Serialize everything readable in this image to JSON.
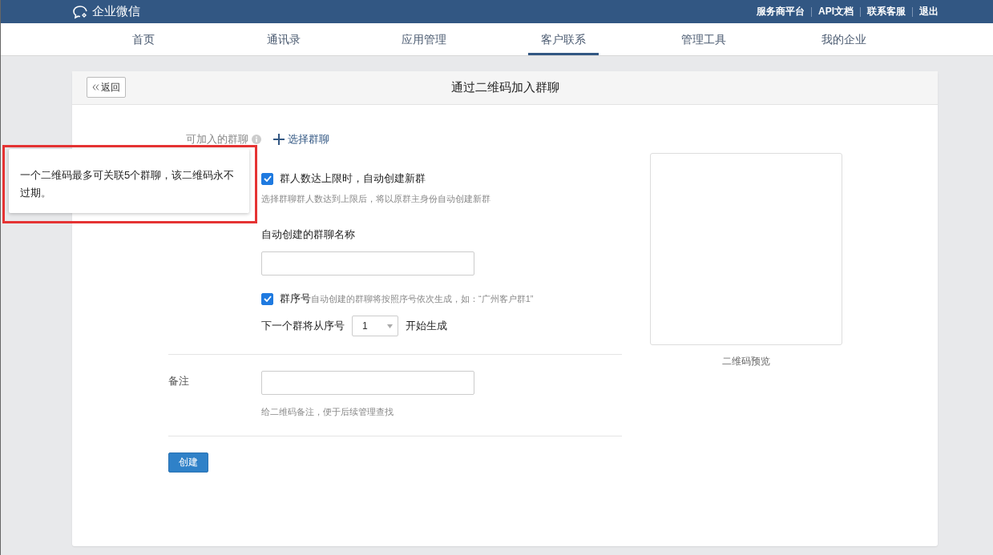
{
  "header": {
    "logo_text": "企业微信",
    "links": [
      "服务商平台",
      "API文档",
      "联系客服",
      "退出"
    ]
  },
  "nav": {
    "tabs": [
      {
        "label": "首页",
        "selected": false
      },
      {
        "label": "通讯录",
        "selected": false
      },
      {
        "label": "应用管理",
        "selected": false
      },
      {
        "label": "客户联系",
        "selected": true
      },
      {
        "label": "管理工具",
        "selected": false
      },
      {
        "label": "我的企业",
        "selected": false
      }
    ]
  },
  "page": {
    "back_button": "返回",
    "title": "通过二维码加入群聊"
  },
  "form": {
    "group_label": "可加入的群聊",
    "select_button": "选择群聊",
    "auto_create": {
      "checked": true,
      "label": "群人数达上限时，自动创建新群",
      "hint": "选择群聊群人数达到上限后，将以原群主身份自动创建新群"
    },
    "name_label": "自动创建的群聊名称",
    "serial": {
      "checked": true,
      "label": "群序号",
      "hint": "自动创建的群聊将按照序号依次生成，如：“广州客户群1”"
    },
    "next_serial": {
      "prefix": "下一个群将从序号",
      "value": "1",
      "suffix": "开始生成"
    },
    "remark": {
      "label": "备注",
      "hint": "给二维码备注，便于后续管理查找"
    },
    "create_button": "创建"
  },
  "preview": {
    "caption": "二维码预览"
  },
  "tooltip": {
    "text": "一个二维码最多可关联5个群聊，该二维码永不过期。"
  }
}
